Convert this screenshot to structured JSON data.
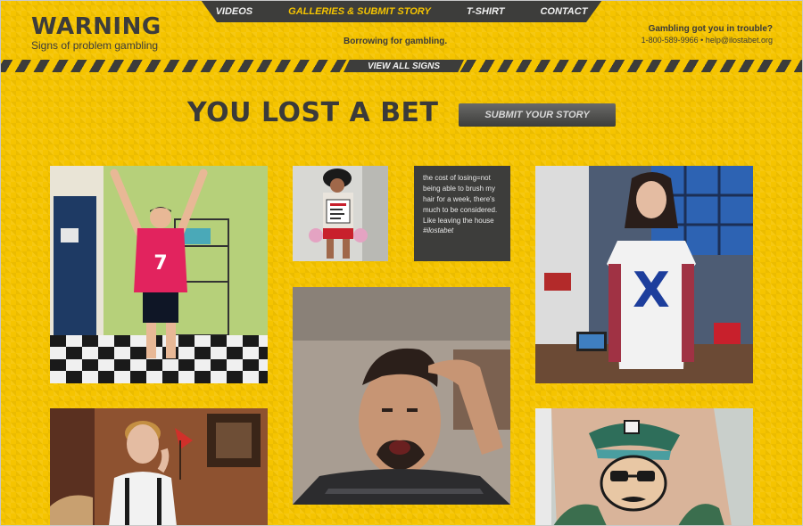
{
  "header": {
    "logo_title": "WARNING",
    "logo_subtitle": "Signs of problem gambling",
    "tagline": "Borrowing for gambling.",
    "contact": {
      "question": "Gambling got you in trouble?",
      "details": "1-800-589-9966 • help@ilostabet.org"
    }
  },
  "nav": {
    "items": [
      {
        "label": "VIDEOS",
        "active": false
      },
      {
        "label": "GALLERIES & SUBMIT STORY",
        "active": true
      },
      {
        "label": "T-SHIRT",
        "active": false
      },
      {
        "label": "CONTACT",
        "active": false
      }
    ],
    "view_all": "VIEW ALL SIGNS"
  },
  "main": {
    "headline": "YOU LOST A BET",
    "submit_label": "SUBMIT YOUR STORY"
  },
  "gallery": {
    "quote_text": "the cost of losing=not being able to brush my hair for a week, there's much to be considered. Like leaving the house",
    "quote_tag": "#ilostabet"
  },
  "colors": {
    "background": "#f5c400",
    "dark": "#3d3d3b"
  }
}
